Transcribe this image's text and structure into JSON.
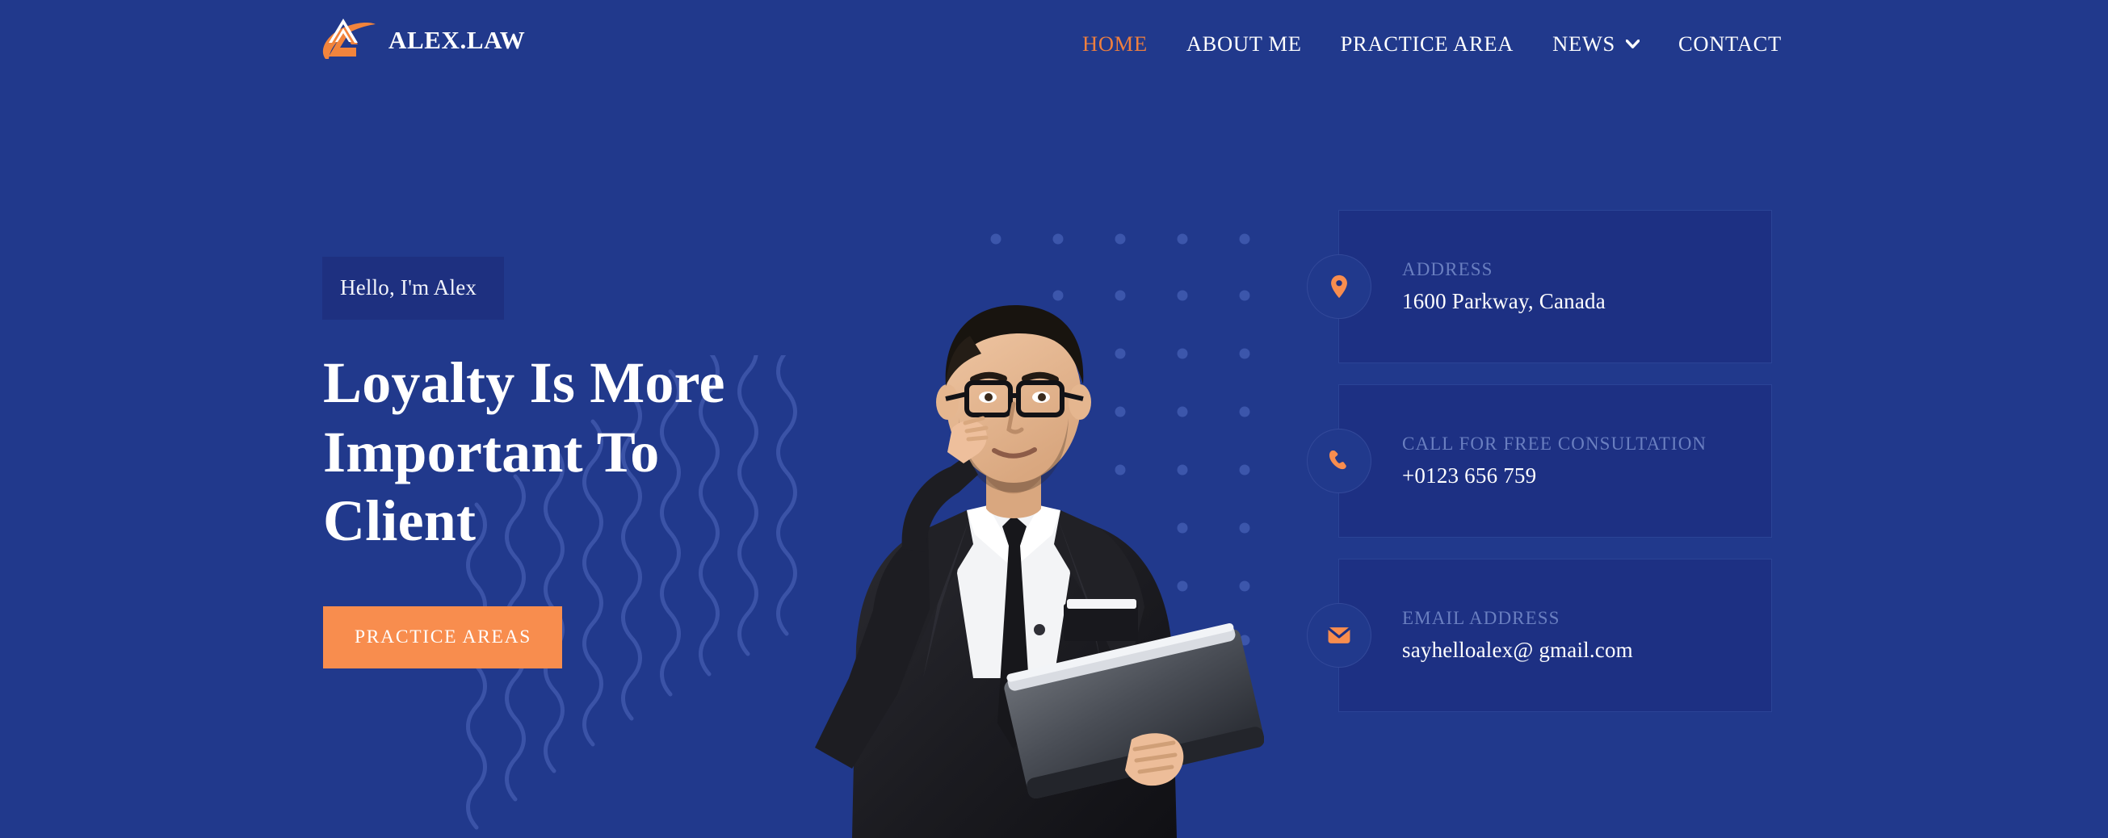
{
  "colors": {
    "background": "#21398c",
    "card_background": "#1d3083",
    "badge_background": "#1e3080",
    "accent_orange": "#f88d4e",
    "nav_active": "#ef7f3e",
    "muted_label": "#6a7fc0",
    "text_white": "#ffffff"
  },
  "header": {
    "brand": {
      "name": "ALEX.LAW",
      "logo_icon": "chevron-swoosh-logo-icon"
    },
    "nav": [
      {
        "label": "HOME",
        "active": true,
        "icon": ""
      },
      {
        "label": "ABOUT ME",
        "active": false,
        "icon": ""
      },
      {
        "label": "PRACTICE AREA",
        "active": false,
        "icon": ""
      },
      {
        "label": "NEWS",
        "active": false,
        "icon": "chevron-down-icon"
      },
      {
        "label": "CONTACT",
        "active": false,
        "icon": ""
      }
    ]
  },
  "hero": {
    "badge": "Hello, I'm Alex",
    "title": "Loyalty Is More Important To Client",
    "cta_label": "PRACTICE AREAS",
    "portrait_alt": "lawyer-portrait"
  },
  "info_cards": [
    {
      "icon": "map-pin-icon",
      "label": "ADDRESS",
      "value": "1600 Parkway, Canada"
    },
    {
      "icon": "phone-icon",
      "label": "CALL FOR FREE CONSULTATION",
      "value": "+0123 656 759"
    },
    {
      "icon": "envelope-icon",
      "label": "EMAIL ADDRESS",
      "value": "sayhelloalex@ gmail.com"
    }
  ],
  "decorations": {
    "wave_pattern": "wavy-lines-decoration",
    "dot_grid": "dot-grid-decoration"
  }
}
